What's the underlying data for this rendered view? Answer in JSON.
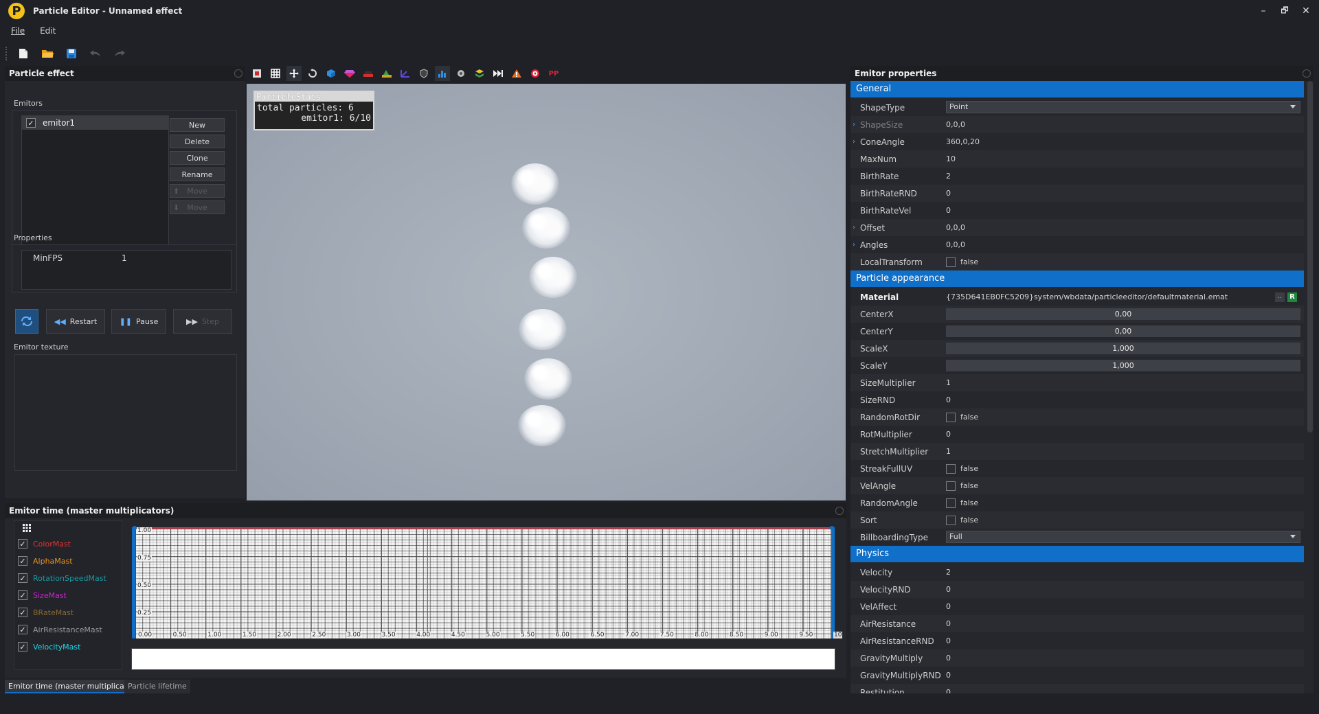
{
  "window": {
    "logo_letter": "P",
    "title": "Particle Editor - Unnamed effect",
    "controls": [
      "–",
      "🗗",
      "✕"
    ]
  },
  "menu": [
    "File",
    "Edit"
  ],
  "colors": {
    "accent": "#0f6fc9",
    "panel_bg": "#25272c",
    "window_bg": "#1f2126",
    "color_mast": "#e03434",
    "alpha_mast": "#e8901a",
    "rotation_mast": "#1a9aa0",
    "size_mast": "#d020d0",
    "brate_mast": "#8a6a30",
    "airres_mast": "#9a9a9a",
    "velocity_mast": "#20d8e8"
  },
  "left_panel": {
    "title": "Particle effect",
    "emitors_label": "Emitors",
    "emitors": [
      {
        "name": "emitor1",
        "checked": true
      }
    ],
    "buttons": {
      "new": "New",
      "delete": "Delete",
      "clone": "Clone",
      "rename": "Rename",
      "move_up": "Move",
      "move_down": "Move"
    },
    "properties_label": "Properties",
    "properties": [
      {
        "name": "MinFPS",
        "value": "1"
      }
    ],
    "controls": {
      "restart": "Restart",
      "pause": "Pause",
      "step": "Step"
    },
    "texture_label": "Emitor texture"
  },
  "viewport": {
    "stats_title": "ParticleStats",
    "stats_line1": "total particles: 6",
    "stats_line2": "emitor1: 6/10"
  },
  "right_panel": {
    "title": "Emitor properties",
    "general": {
      "title": "General",
      "shape_type": {
        "name": "ShapeType",
        "value": "Point"
      },
      "shape_size": {
        "name": "ShapeSize",
        "value": "0,0,0"
      },
      "cone_angle": {
        "name": "ConeAngle",
        "value": "360,0,20"
      },
      "max_num": {
        "name": "MaxNum",
        "value": "10"
      },
      "birth_rate": {
        "name": "BirthRate",
        "value": "2"
      },
      "birth_rate_rnd": {
        "name": "BirthRateRND",
        "value": "0"
      },
      "birth_rate_vel": {
        "name": "BirthRateVel",
        "value": "0"
      },
      "offset": {
        "name": "Offset",
        "value": "0,0,0"
      },
      "angles": {
        "name": "Angles",
        "value": "0,0,0"
      },
      "local_transform": {
        "name": "LocalTransform",
        "value": "false"
      }
    },
    "appearance": {
      "title": "Particle appearance",
      "material": {
        "name": "Material",
        "value": "{735D641EB0FC5209}system/wbdata/particleeditor/defaultmaterial.emat",
        "browse": "..",
        "reset": "R"
      },
      "center_x": {
        "name": "CenterX",
        "value": "0,00"
      },
      "center_y": {
        "name": "CenterY",
        "value": "0,00"
      },
      "scale_x": {
        "name": "ScaleX",
        "value": "1,000"
      },
      "scale_y": {
        "name": "ScaleY",
        "value": "1,000"
      },
      "size_multiplier": {
        "name": "SizeMultiplier",
        "value": "1"
      },
      "size_rnd": {
        "name": "SizeRND",
        "value": "0"
      },
      "random_rot_dir": {
        "name": "RandomRotDir",
        "value": "false"
      },
      "rot_multiplier": {
        "name": "RotMultiplier",
        "value": "0"
      },
      "stretch_multiplier": {
        "name": "StretchMultiplier",
        "value": "1"
      },
      "streak_full_uv": {
        "name": "StreakFullUV",
        "value": "false"
      },
      "vel_angle": {
        "name": "VelAngle",
        "value": "false"
      },
      "random_angle": {
        "name": "RandomAngle",
        "value": "false"
      },
      "sort": {
        "name": "Sort",
        "value": "false"
      },
      "billboarding_type": {
        "name": "BillboardingType",
        "value": "Full"
      }
    },
    "physics": {
      "title": "Physics",
      "velocity": {
        "name": "Velocity",
        "value": "2"
      },
      "velocity_rnd": {
        "name": "VelocityRND",
        "value": "0"
      },
      "vel_affect": {
        "name": "VelAffect",
        "value": "0"
      },
      "air_resistance": {
        "name": "AirResistance",
        "value": "0"
      },
      "air_resistance_rnd": {
        "name": "AirResistanceRND",
        "value": "0"
      },
      "gravity_multiply": {
        "name": "GravityMultiply",
        "value": "0"
      },
      "gravity_multiply_rnd": {
        "name": "GravityMultiplyRND",
        "value": "0"
      },
      "restitution": {
        "name": "Restitution",
        "value": "0"
      }
    }
  },
  "bottom_panel": {
    "title": "Emitor time (master multiplicators)",
    "masts": [
      {
        "name": "ColorMast",
        "color": "#e03434"
      },
      {
        "name": "AlphaMast",
        "color": "#e8901a"
      },
      {
        "name": "RotationSpeedMast",
        "color": "#1a9aa0"
      },
      {
        "name": "SizeMast",
        "color": "#d020d0"
      },
      {
        "name": "BRateMast",
        "color": "#8a6a30"
      },
      {
        "name": "AirResistanceMast",
        "color": "#9a9a9a"
      },
      {
        "name": "VelocityMast",
        "color": "#20d8e8"
      }
    ],
    "y_ticks": [
      "1.00",
      "0.75",
      "0.50",
      "0.25"
    ],
    "x_ticks": [
      "0.00",
      "0.50",
      "1.00",
      "1.50",
      "2.00",
      "2.50",
      "3.00",
      "3.50",
      "4.00",
      "4.50",
      "5.00",
      "5.50",
      "6.00",
      "6.50",
      "7.00",
      "7.50",
      "8.00",
      "8.50",
      "9.00",
      "9.50",
      "10"
    ],
    "cursor_time": 4.2,
    "tabs": [
      "Emitor time (master multiplicators)",
      "Particle lifetime"
    ]
  }
}
